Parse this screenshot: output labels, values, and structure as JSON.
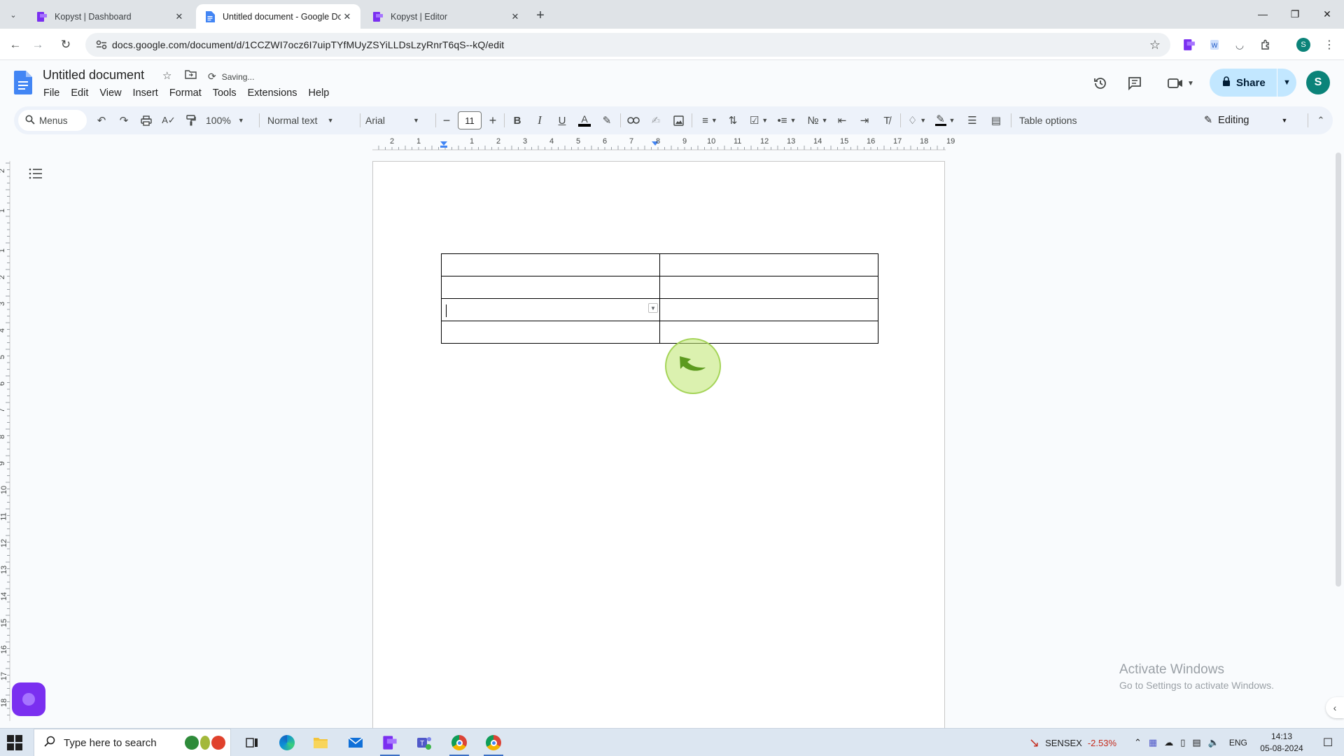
{
  "browser": {
    "tabs": [
      {
        "title": "Kopyst | Dashboard",
        "active": false
      },
      {
        "title": "Untitled document - Google Docs",
        "active": true
      },
      {
        "title": "Kopyst | Editor",
        "active": false
      }
    ],
    "url": "docs.google.com/document/d/1CCZWI7ocz6I7uipTYfMUyZSYiLLDsLzyRnrT6qS--kQ/edit"
  },
  "docs": {
    "title": "Untitled document",
    "status": "Saving...",
    "menu": [
      "File",
      "Edit",
      "View",
      "Insert",
      "Format",
      "Tools",
      "Extensions",
      "Help"
    ],
    "share_label": "Share",
    "avatar_initial": "S"
  },
  "toolbar": {
    "search_label": "Menus",
    "zoom": "100%",
    "style": "Normal text",
    "font": "Arial",
    "font_size": "11",
    "table_options": "Table options",
    "mode": "Editing"
  },
  "ruler": {
    "h_numbers": [
      "2",
      "1",
      "1",
      "2",
      "3",
      "4",
      "5",
      "6",
      "7",
      "8",
      "9",
      "10",
      "11",
      "12",
      "13",
      "14",
      "15",
      "16",
      "17",
      "18",
      "19"
    ],
    "v_numbers": [
      "2",
      "1",
      "1",
      "2",
      "3",
      "4",
      "5",
      "6",
      "7",
      "8",
      "9",
      "10",
      "11",
      "12",
      "13",
      "14",
      "15",
      "16",
      "17",
      "18"
    ]
  },
  "table": {
    "rows": 4,
    "cols": 2,
    "cursor_row": 2,
    "cursor_col": 0
  },
  "watermark": {
    "line1": "Activate Windows",
    "line2": "Go to Settings to activate Windows."
  },
  "taskbar": {
    "search_placeholder": "Type here to search",
    "sensex_label": "SENSEX",
    "sensex_change": "-2.53%",
    "language": "ENG",
    "time": "14:13",
    "date": "05-08-2024"
  },
  "colors": {
    "share_bg": "#c2e7ff",
    "avatar_bg": "#0b8379",
    "toolbar_bg": "#edf2fa",
    "docs_blue": "#4285f4",
    "kopyst_purple": "#7a2ff0"
  }
}
